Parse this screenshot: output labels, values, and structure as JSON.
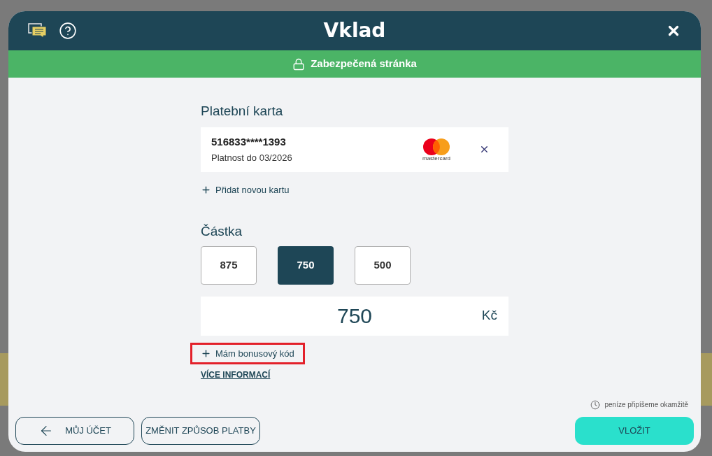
{
  "header": {
    "title": "Vklad"
  },
  "secure_banner": {
    "text": "Zabezpečená stránka"
  },
  "payment_card": {
    "heading": "Platební karta",
    "number": "516833****1393",
    "expiry": "Platnost do 03/2026",
    "brand_logo_text": "mastercard",
    "add_card": "Přidat novou kartu"
  },
  "amount": {
    "heading": "Částka",
    "presets": [
      {
        "label": "875",
        "selected": false
      },
      {
        "label": "750",
        "selected": true
      },
      {
        "label": "500",
        "selected": false
      }
    ],
    "value": "750",
    "currency": "Kč"
  },
  "bonus_link": {
    "text": "Mám bonusový kód",
    "highlighted": true
  },
  "more_info": "VÍCE INFORMACÍ",
  "instant_note": "peníze připíšeme okamžitě",
  "footer": {
    "back": "MŮJ ÚČET",
    "change_method": "ZMĚNIT ZPŮSOB PLATBY",
    "submit": "VLOŽIT"
  }
}
